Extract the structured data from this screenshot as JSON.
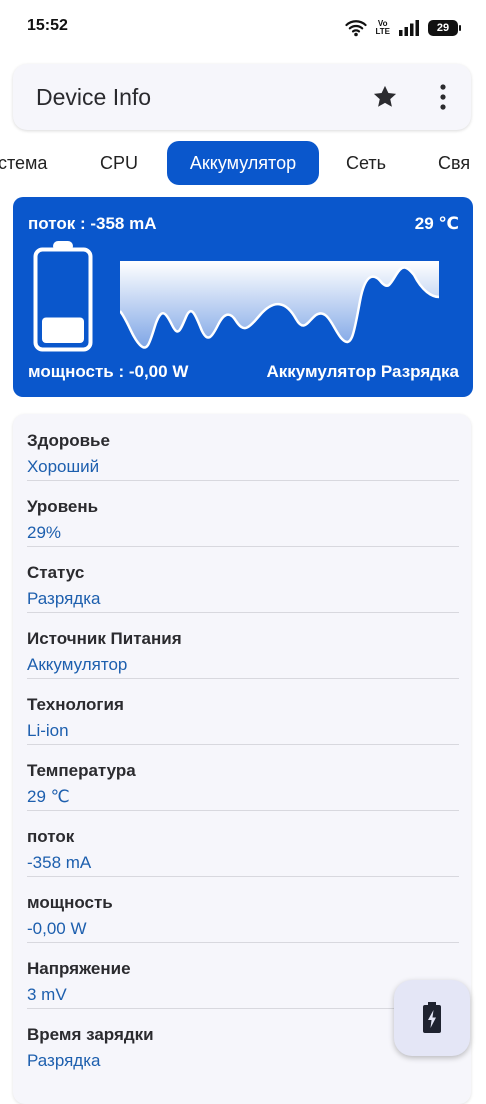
{
  "status_bar": {
    "time": "15:52",
    "volte_top": "Vo",
    "volte_bottom": "LTE",
    "battery_level": "29",
    "icons": [
      "wifi-icon",
      "volte-icon",
      "signal-icon",
      "battery-icon"
    ]
  },
  "app_bar": {
    "title": "Device Info",
    "icons": [
      "star-icon",
      "more-vert-icon"
    ]
  },
  "tabs": {
    "items": [
      {
        "label": "стема"
      },
      {
        "label": "CPU"
      },
      {
        "label": "Аккумулятор"
      },
      {
        "label": "Сеть"
      },
      {
        "label": "Свя"
      }
    ],
    "active_index": 2
  },
  "battery_card": {
    "current": "поток : -358 mA",
    "temperature": "29 ℃",
    "power": "мощность : -0,00 W",
    "status": "Аккумулятор Разрядка",
    "battery_fill_fraction": 0.29,
    "colors": {
      "background": "#0a57cc",
      "text": "#ffffff"
    }
  },
  "info": {
    "rows": [
      {
        "label": "Здоровье",
        "value": "Хороший"
      },
      {
        "label": "Уровень",
        "value": "29%"
      },
      {
        "label": "Статус",
        "value": "Разрядка"
      },
      {
        "label": "Источник Питания",
        "value": "Аккумулятор"
      },
      {
        "label": "Технология",
        "value": "Li-ion"
      },
      {
        "label": "Температура",
        "value": "29 ℃"
      },
      {
        "label": "поток",
        "value": "-358 mA"
      },
      {
        "label": "мощность",
        "value": "-0,00 W"
      },
      {
        "label": "Напряжение",
        "value": "3 mV"
      },
      {
        "label": "Время зарядки",
        "value": "Разрядка"
      }
    ]
  },
  "fab": {
    "icon": "battery-charging-icon"
  },
  "colors": {
    "accent": "#0a57cc",
    "value_text": "#1d5fae",
    "card_background": "#f6f6fb"
  }
}
